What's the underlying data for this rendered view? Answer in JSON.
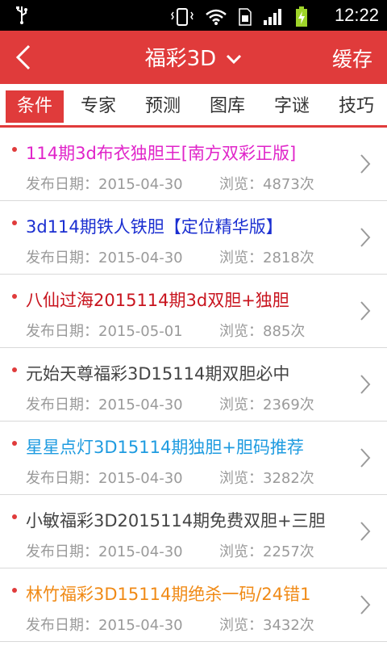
{
  "status_bar": {
    "time": "12:22"
  },
  "nav": {
    "title": "福彩3D",
    "cache_label": "缓存"
  },
  "tabs": [
    {
      "label": "条件",
      "active": true
    },
    {
      "label": "专家",
      "active": false
    },
    {
      "label": "预测",
      "active": false
    },
    {
      "label": "图库",
      "active": false
    },
    {
      "label": "字谜",
      "active": false
    },
    {
      "label": "技巧",
      "active": false
    }
  ],
  "articles": [
    {
      "title": "114期3d布衣独胆王[南方双彩正版]",
      "date_label": "发布日期：2015-04-30",
      "views_label": "浏览：4873次",
      "color": "#e024c9"
    },
    {
      "title": "3d114期铁人铁胆【定位精华版】",
      "date_label": "发布日期：2015-04-30",
      "views_label": "浏览：2818次",
      "color": "#1b2fd1"
    },
    {
      "title": "八仙过海2015114期3d双胆+独胆",
      "date_label": "发布日期：2015-05-01",
      "views_label": "浏览：885次",
      "color": "#c8141e"
    },
    {
      "title": "元始天尊福彩3D15114期双胆必中",
      "date_label": "发布日期：2015-04-30",
      "views_label": "浏览：2369次",
      "color": "#444444"
    },
    {
      "title": "星星点灯3D15114期独胆+胆码推荐",
      "date_label": "发布日期：2015-04-30",
      "views_label": "浏览：3282次",
      "color": "#1e9be0"
    },
    {
      "title": "小敏福彩3D2015114期免费双胆+三胆",
      "date_label": "发布日期：2015-04-30",
      "views_label": "浏览：2257次",
      "color": "#444444"
    },
    {
      "title": "林竹福彩3D15114期绝杀一码/24错1",
      "date_label": "发布日期：2015-04-30",
      "views_label": "浏览：3432次",
      "color": "#f08a16"
    }
  ],
  "colors": {
    "accent": "#e03b3b"
  }
}
